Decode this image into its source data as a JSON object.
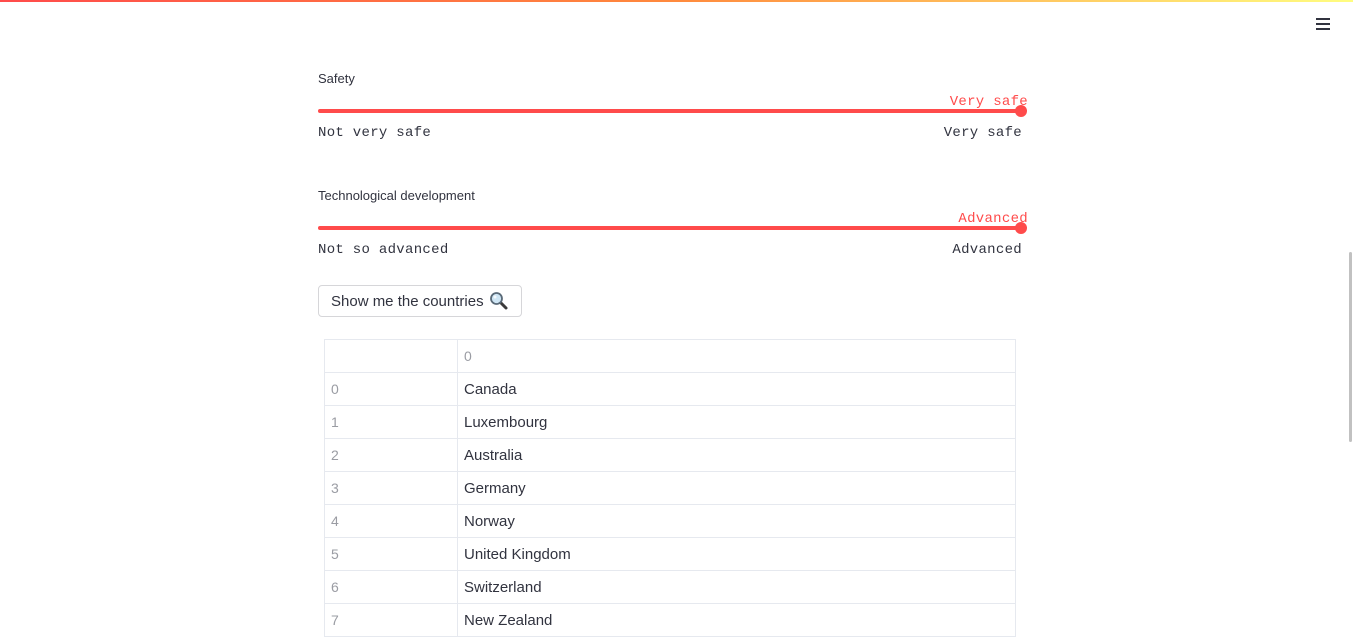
{
  "header": {
    "menu_icon": "hamburger-menu-icon"
  },
  "sliders": [
    {
      "label": "Safety",
      "value": "Very safe",
      "min_label": "Not very safe",
      "max_label": "Very safe",
      "position": 1.0
    },
    {
      "label": "Technological development",
      "value": "Advanced",
      "min_label": "Not so advanced",
      "max_label": "Advanced",
      "position": 1.0
    }
  ],
  "button": {
    "label": "Show me the countries",
    "icon": "magnifying-glass-icon"
  },
  "table": {
    "columns": [
      "",
      "0"
    ],
    "rows": [
      {
        "index": "0",
        "value": "Canada"
      },
      {
        "index": "1",
        "value": "Luxembourg"
      },
      {
        "index": "2",
        "value": "Australia"
      },
      {
        "index": "3",
        "value": "Germany"
      },
      {
        "index": "4",
        "value": "Norway"
      },
      {
        "index": "5",
        "value": "United Kingdom"
      },
      {
        "index": "6",
        "value": "Switzerland"
      },
      {
        "index": "7",
        "value": "New Zealand"
      }
    ]
  },
  "colors": {
    "accent": "#ff4b4b",
    "text": "#31333f",
    "muted": "#9a9ca3",
    "border": "#e6e9ef"
  }
}
